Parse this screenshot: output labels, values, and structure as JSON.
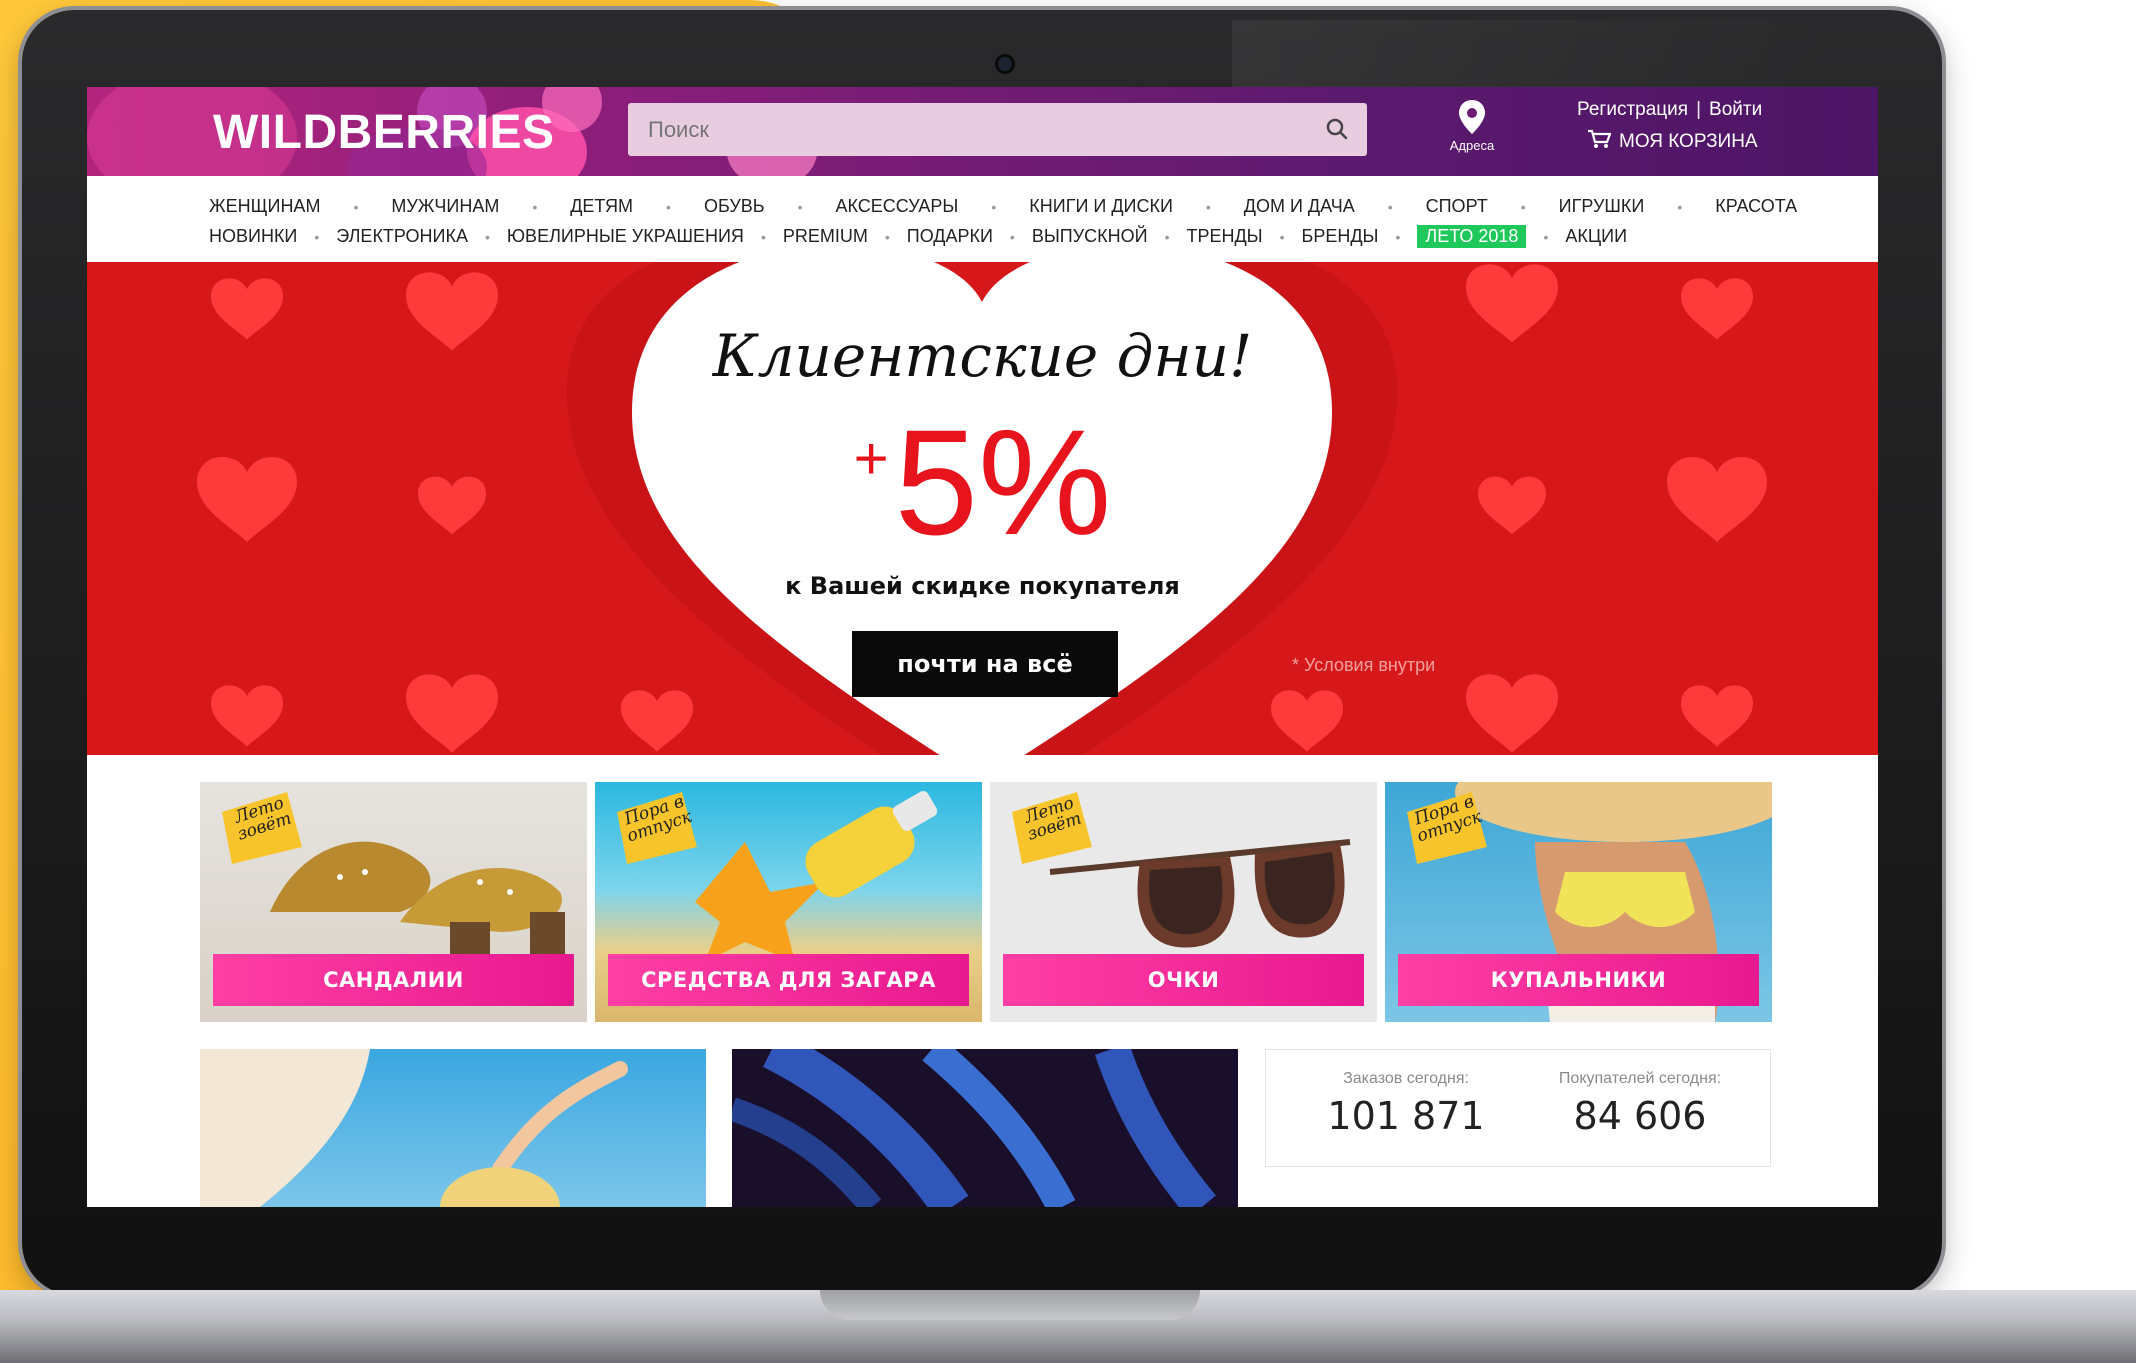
{
  "header": {
    "logo": "WILDBERRIES",
    "search_placeholder": "Поиск",
    "address_label": "Адреса",
    "register_label": "Регистрация",
    "auth_separator": "|",
    "login_label": "Войти",
    "cart_label": "МОЯ КОРЗИНА"
  },
  "nav": {
    "row1": [
      "ЖЕНЩИНАМ",
      "МУЖЧИНАМ",
      "ДЕТЯМ",
      "ОБУВЬ",
      "АКСЕССУАРЫ",
      "КНИГИ И ДИСКИ",
      "ДОМ И ДАЧА",
      "СПОРТ",
      "ИГРУШКИ",
      "КРАСОТА"
    ],
    "row2": [
      "НОВИНКИ",
      "ЭЛЕКТРОНИКА",
      "ЮВЕЛИРНЫЕ УКРАШЕНИЯ",
      "PREMIUM",
      "ПОДАРКИ",
      "ВЫПУСКНОЙ",
      "ТРЕНДЫ",
      "БРЕНДЫ",
      "ЛЕТО 2018",
      "АКЦИИ"
    ],
    "highlight": "ЛЕТО 2018",
    "highlight_color": "#1fc85a"
  },
  "banner": {
    "title": "Клиентские дни!",
    "plus": "+",
    "percent": "5%",
    "subtitle": "к Вашей скидке покупателя",
    "button": "почти на всё",
    "conditions": "* Условия внутри",
    "bg_color": "#d6181a"
  },
  "categories": [
    {
      "label": "САНДАЛИИ",
      "sticker": "Лето зовёт"
    },
    {
      "label": "СРЕДСТВА ДЛЯ ЗАГАРА",
      "sticker": "Пора в отпуск"
    },
    {
      "label": "ОЧКИ",
      "sticker": "Лето зовёт"
    },
    {
      "label": "КУПАЛЬНИКИ",
      "sticker": "Пора в отпуск"
    }
  ],
  "stats": {
    "orders_label": "Заказов сегодня:",
    "orders_value": "101 871",
    "customers_label": "Покупателей сегодня:",
    "customers_value": "84 606"
  },
  "colors": {
    "brand_purple": "#5c1a6e",
    "brand_pink": "#e8188f",
    "yellow": "#ffc83a"
  }
}
